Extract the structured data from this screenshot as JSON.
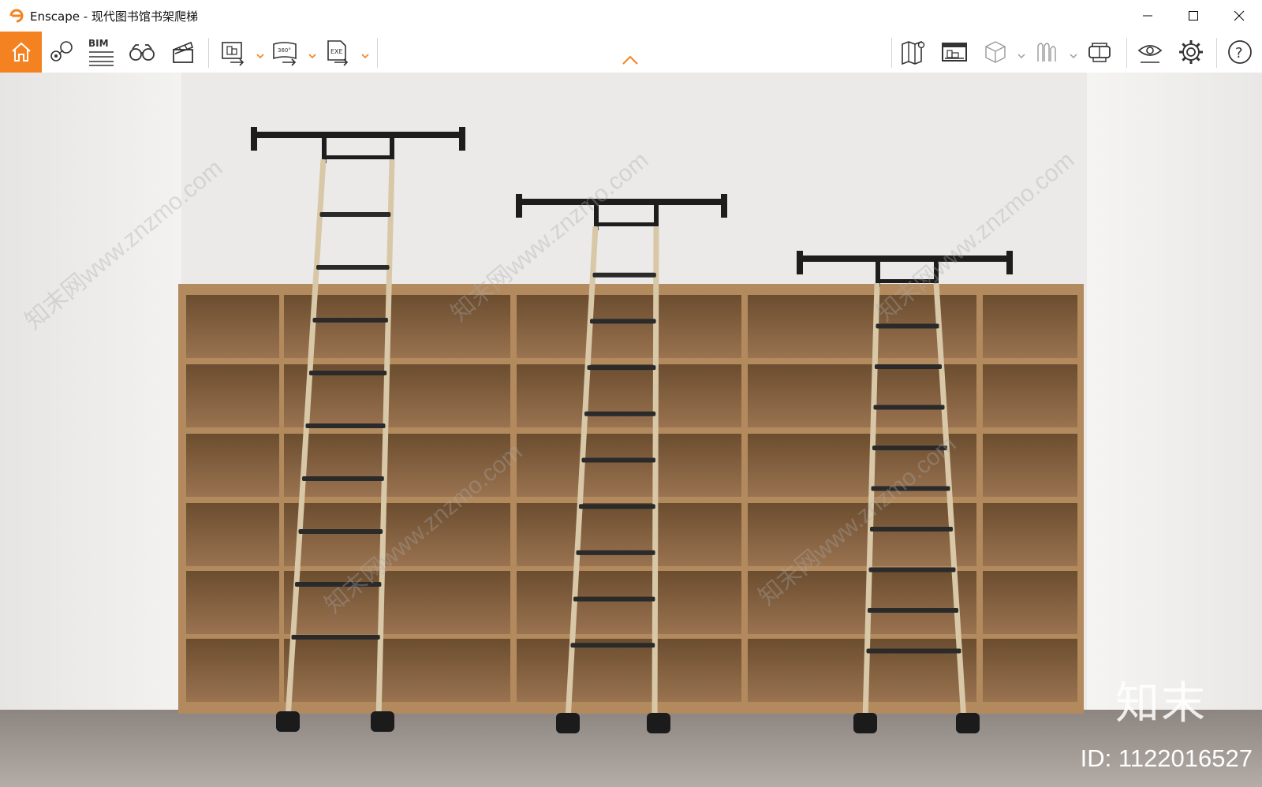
{
  "window": {
    "app_name": "Enscape",
    "title": "Enscape - 现代图书馆书架爬梯",
    "controls": [
      "minimize",
      "maximize",
      "close"
    ]
  },
  "toolbar": {
    "bim_label": "BIM",
    "left_tools": [
      "home-icon",
      "location-pin-icon",
      "bim-icon",
      "binoculars-icon",
      "clapperboard-icon"
    ],
    "export_tools": [
      "screenshot-export-icon",
      "panorama-360-export-icon",
      "exe-export-icon"
    ],
    "panorama_label": "360°",
    "exe_label": "EXE",
    "right_tools": [
      "map-icon",
      "monitor-icon",
      "cube-icon",
      "asset-library-icon",
      "vr-headset-icon",
      "visual-settings-eye-icon",
      "settings-gear-icon",
      "help-icon"
    ],
    "help_label": "?",
    "accent_color": "#f58220"
  },
  "viewport": {
    "scene": "modern library bookshelf with rolling ladders",
    "watermark_text": "知末",
    "watermark_id": "ID: 1122016527",
    "diagonal_watermark": "知末网www.znzmo.com"
  }
}
